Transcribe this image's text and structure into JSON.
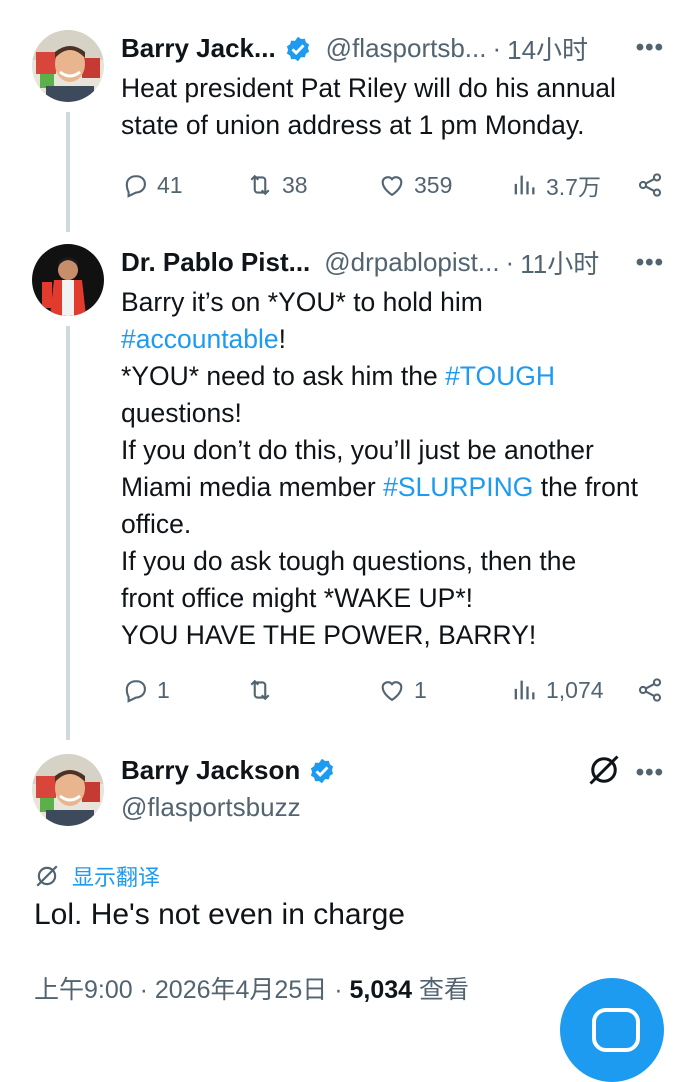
{
  "tweets": [
    {
      "name": "Barry Jack...",
      "handle": "@flasportsb...",
      "time": "14小时",
      "lines": [
        "Heat president Pat Riley will do his annual",
        "state of union address at 1 pm Monday."
      ],
      "replies": "41",
      "retweets": "38",
      "likes": "359",
      "views": "3.7万"
    },
    {
      "name": "Dr. Pablo Pist...",
      "handle": "@drpablopist...",
      "time": "11小时",
      "line1": "Barry it’s on *YOU* to hold him",
      "line2_tag": "#accountable",
      "line2_rest": "!",
      "line3_pre": "*YOU* need to ask him the ",
      "line3_tag": "#TOUGH",
      "line4": "questions!",
      "line5": "If you don’t do this, you’ll just be another",
      "line6_pre": "Miami media member ",
      "line6_tag": "#SLURPING",
      "line6_rest": " the front",
      "line7": "office.",
      "line8": "If you do ask tough questions, then the",
      "line9": "front office might *WAKE UP*!",
      "line10": "YOU HAVE THE POWER, BARRY!",
      "replies": "1",
      "likes": "1",
      "views": "1,074"
    }
  ],
  "main": {
    "name": "Barry Jackson",
    "handle": "@flasportsbuzz",
    "translate": "显示翻译",
    "text": "Lol. He's not even in charge",
    "time": "上午9:00",
    "date": "2026年4月25日",
    "views": "5,034",
    "views_label": "查看"
  },
  "dot": "·",
  "more": "•••",
  "colors": {
    "accent": "#1d9bf0",
    "secondary": "#536471",
    "line": "#cfd9de"
  }
}
